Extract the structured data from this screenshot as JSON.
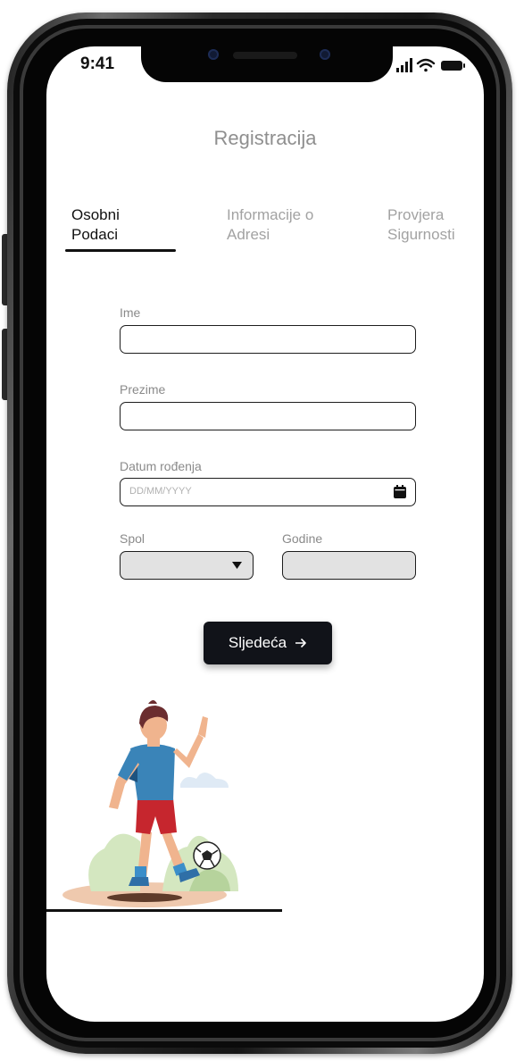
{
  "status_bar": {
    "time": "9:41"
  },
  "header": {
    "title": "Registracija"
  },
  "tabs": [
    {
      "line1": "Osobni",
      "line2": "Podaci",
      "active": true
    },
    {
      "line1": "Informacije o",
      "line2": "Adresi",
      "active": false
    },
    {
      "line1": "Provjera",
      "line2": "Sigurnosti",
      "active": false
    }
  ],
  "form": {
    "first_name": {
      "label": "Ime",
      "value": ""
    },
    "last_name": {
      "label": "Prezime",
      "value": ""
    },
    "birth_date": {
      "label": "Datum rođenja",
      "placeholder": "DD/MM/YYYY",
      "icon": "calendar-icon"
    },
    "gender": {
      "label": "Spol",
      "value": "",
      "icon": "caret-down-icon"
    },
    "age": {
      "label": "Godine",
      "value": ""
    }
  },
  "actions": {
    "next_label": "Sljedeća",
    "next_icon": "arrow-right-icon"
  },
  "colors": {
    "primary_button": "#111319",
    "field_border": "#1d1d1d",
    "disabled_field": "#e2e2e2"
  }
}
